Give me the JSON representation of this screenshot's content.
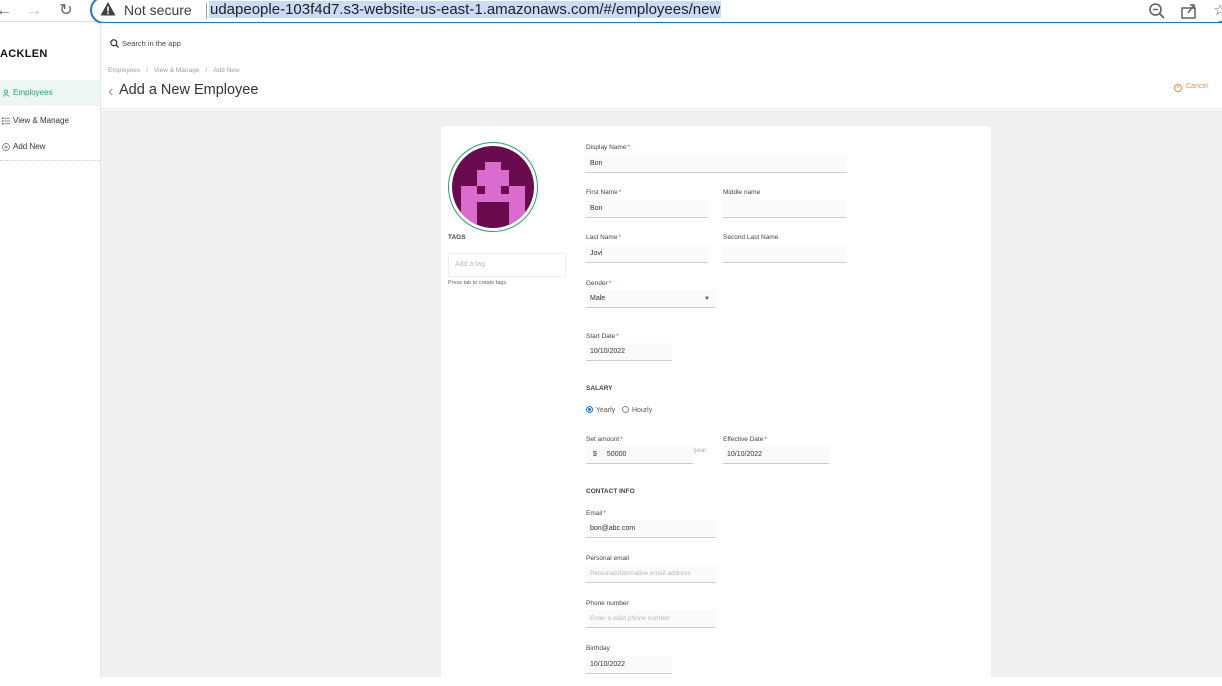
{
  "browser": {
    "security": "Not secure",
    "url": "udapeople-103f4d7.s3-website-us-east-1.amazonaws.com/#/employees/new"
  },
  "sidebar": {
    "logo": "ACKLEN",
    "items": [
      {
        "label": "Employees",
        "icon": "person-icon"
      },
      {
        "label": "View & Manage",
        "icon": "list-icon"
      },
      {
        "label": "Add New",
        "icon": "plus-circle-icon"
      }
    ]
  },
  "header": {
    "search_placeholder": "Search in the app",
    "breadcrumb": [
      "Employees",
      "View & Manage",
      "Add New"
    ],
    "title": "Add a New Employee",
    "cancel_label": "Cancel"
  },
  "profile": {
    "tags_label": "TAGS",
    "tag_placeholder": "Add a tag",
    "tag_hint": "Press tab to create tags."
  },
  "form": {
    "display_name": {
      "label": "Display Name",
      "value": "Bon"
    },
    "first_name": {
      "label": "First Name",
      "value": "Bon"
    },
    "middle_name": {
      "label": "Middle name",
      "value": ""
    },
    "last_name": {
      "label": "Last Name",
      "value": "Jovi"
    },
    "second_last_name": {
      "label": "Second Last Name",
      "value": ""
    },
    "gender": {
      "label": "Gender",
      "value": "Male"
    },
    "start_date": {
      "label": "Start Date",
      "value": "10/10/2022"
    },
    "salary_section": "SALARY",
    "salary_type": {
      "yearly": "Yearly",
      "hourly": "Hourly",
      "selected": "Yearly"
    },
    "set_amount": {
      "label": "Set amount",
      "currency": "$",
      "value": "50000",
      "unit": "/year"
    },
    "effective_date": {
      "label": "Effective Date",
      "value": "10/10/2022"
    },
    "contact_section": "CONTACT INFO",
    "email": {
      "label": "Email",
      "value": "bon@abc.com"
    },
    "personal_email": {
      "label": "Personal email",
      "placeholder": "Personal/Alternative email address"
    },
    "phone": {
      "label": "Phone number",
      "placeholder": "Enter a valid phone number"
    },
    "birthday": {
      "label": "Birthday",
      "value": "10/10/2022"
    }
  },
  "colors": {
    "accent": "#26a269",
    "cancel": "#f08c4a",
    "avatar_bg": "#6a0b4f",
    "avatar_fg": "#d96ccc",
    "required": "#e53935"
  }
}
